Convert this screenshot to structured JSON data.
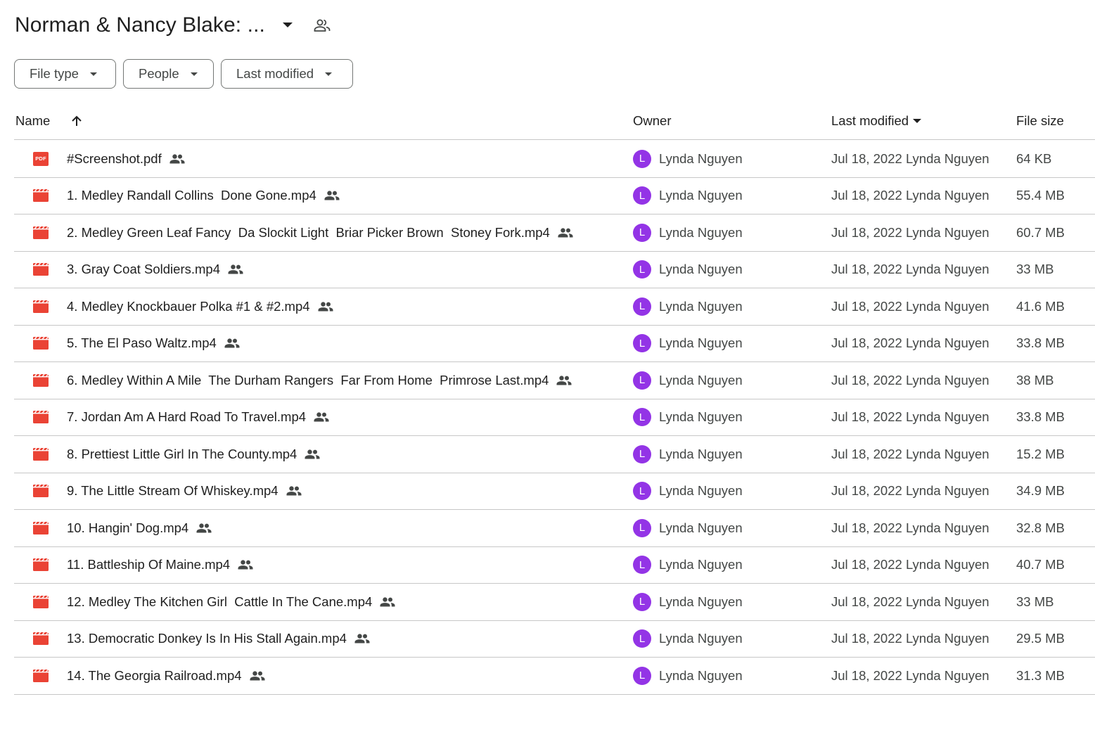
{
  "folder": {
    "title": "Norman & Nancy Blake: ...",
    "title_menu_icon": "arrow-drop-down-icon",
    "shared_icon": "people-outline-icon"
  },
  "filters": [
    {
      "label": "File type"
    },
    {
      "label": "People"
    },
    {
      "label": "Last modified"
    }
  ],
  "columns": {
    "name": "Name",
    "owner": "Owner",
    "last_modified": "Last modified",
    "file_size": "File size",
    "sort_icon": "arrow-upward-icon"
  },
  "colors": {
    "avatar": "#9334e6",
    "pdf_icon": "#ea4335",
    "video_icon": "#ea4335",
    "divider": "#c7c7c7"
  },
  "files": [
    {
      "name": "#Screenshot.pdf",
      "type": "pdf",
      "type_label": "PDF",
      "owner_initial": "L",
      "owner": "Lynda Nguyen",
      "modified": "Jul 18, 2022 Lynda Nguyen",
      "size": "64 KB"
    },
    {
      "name": "1. Medley Randall Collins  Done Gone.mp4",
      "type": "video",
      "owner_initial": "L",
      "owner": "Lynda Nguyen",
      "modified": "Jul 18, 2022 Lynda Nguyen",
      "size": "55.4 MB"
    },
    {
      "name": "2. Medley Green Leaf Fancy  Da Slockit Light  Briar Picker Brown  Stoney Fork.mp4",
      "type": "video",
      "owner_initial": "L",
      "owner": "Lynda Nguyen",
      "modified": "Jul 18, 2022 Lynda Nguyen",
      "size": "60.7 MB"
    },
    {
      "name": "3. Gray Coat Soldiers.mp4",
      "type": "video",
      "owner_initial": "L",
      "owner": "Lynda Nguyen",
      "modified": "Jul 18, 2022 Lynda Nguyen",
      "size": "33 MB"
    },
    {
      "name": "4. Medley Knockbauer Polka #1 & #2.mp4",
      "type": "video",
      "owner_initial": "L",
      "owner": "Lynda Nguyen",
      "modified": "Jul 18, 2022 Lynda Nguyen",
      "size": "41.6 MB"
    },
    {
      "name": "5. The El Paso Waltz.mp4",
      "type": "video",
      "owner_initial": "L",
      "owner": "Lynda Nguyen",
      "modified": "Jul 18, 2022 Lynda Nguyen",
      "size": "33.8 MB"
    },
    {
      "name": "6. Medley Within A Mile  The Durham Rangers  Far From Home  Primrose Last.mp4",
      "type": "video",
      "owner_initial": "L",
      "owner": "Lynda Nguyen",
      "modified": "Jul 18, 2022 Lynda Nguyen",
      "size": "38 MB"
    },
    {
      "name": "7. Jordan Am A Hard Road To Travel.mp4",
      "type": "video",
      "owner_initial": "L",
      "owner": "Lynda Nguyen",
      "modified": "Jul 18, 2022 Lynda Nguyen",
      "size": "33.8 MB"
    },
    {
      "name": "8. Prettiest Little Girl In The County.mp4",
      "type": "video",
      "owner_initial": "L",
      "owner": "Lynda Nguyen",
      "modified": "Jul 18, 2022 Lynda Nguyen",
      "size": "15.2 MB"
    },
    {
      "name": "9. The Little Stream Of Whiskey.mp4",
      "type": "video",
      "owner_initial": "L",
      "owner": "Lynda Nguyen",
      "modified": "Jul 18, 2022 Lynda Nguyen",
      "size": "34.9 MB"
    },
    {
      "name": "10. Hangin' Dog.mp4",
      "type": "video",
      "owner_initial": "L",
      "owner": "Lynda Nguyen",
      "modified": "Jul 18, 2022 Lynda Nguyen",
      "size": "32.8 MB"
    },
    {
      "name": "11. Battleship Of Maine.mp4",
      "type": "video",
      "owner_initial": "L",
      "owner": "Lynda Nguyen",
      "modified": "Jul 18, 2022 Lynda Nguyen",
      "size": "40.7 MB"
    },
    {
      "name": "12. Medley The Kitchen Girl  Cattle In The Cane.mp4",
      "type": "video",
      "owner_initial": "L",
      "owner": "Lynda Nguyen",
      "modified": "Jul 18, 2022 Lynda Nguyen",
      "size": "33 MB"
    },
    {
      "name": "13. Democratic Donkey Is In His Stall Again.mp4",
      "type": "video",
      "owner_initial": "L",
      "owner": "Lynda Nguyen",
      "modified": "Jul 18, 2022 Lynda Nguyen",
      "size": "29.5 MB"
    },
    {
      "name": "14. The Georgia Railroad.mp4",
      "type": "video",
      "owner_initial": "L",
      "owner": "Lynda Nguyen",
      "modified": "Jul 18, 2022 Lynda Nguyen",
      "size": "31.3 MB"
    }
  ]
}
